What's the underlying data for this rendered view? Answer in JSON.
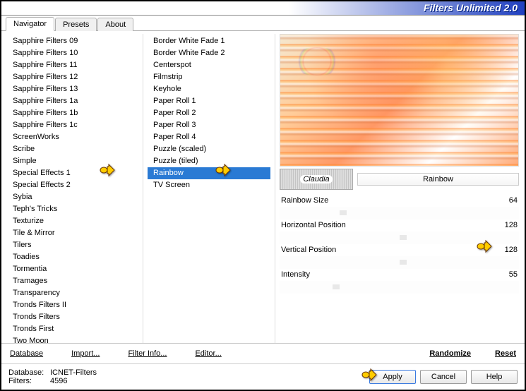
{
  "title": "Filters Unlimited 2.0",
  "tabs": [
    "Navigator",
    "Presets",
    "About"
  ],
  "activeTab": 0,
  "categories": [
    "Sapphire Filters 09",
    "Sapphire Filters 10",
    "Sapphire Filters 11",
    "Sapphire Filters 12",
    "Sapphire Filters 13",
    "Sapphire Filters 1a",
    "Sapphire Filters 1b",
    "Sapphire Filters 1c",
    "ScreenWorks",
    "Scribe",
    "Simple",
    "Special Effects 1",
    "Special Effects 2",
    "Sybia",
    "Teph's Tricks",
    "Texturize",
    "Tile & Mirror",
    "Tilers",
    "Toadies",
    "Tormentia",
    "Tramages",
    "Transparency",
    "Tronds Filters II",
    "Tronds Filters",
    "Tronds First",
    "Two Moon"
  ],
  "selectedCategoryIndex": 12,
  "filters": [
    "Border White Fade 1",
    "Border White Fade 2",
    "Centerspot",
    "Filmstrip",
    "Keyhole",
    "Paper Roll 1",
    "Paper Roll 2",
    "Paper Roll 3",
    "Paper Roll 4",
    "Puzzle (scaled)",
    "Puzzle (tiled)",
    "Rainbow",
    "TV Screen"
  ],
  "selectedFilterIndex": 11,
  "currentFilterName": "Rainbow",
  "logoText": "Claudia",
  "params": [
    {
      "label": "Rainbow Size",
      "value": "64",
      "pos": 25
    },
    {
      "label": "Horizontal Position",
      "value": "128",
      "pos": 50
    },
    {
      "label": "Vertical Position",
      "value": "128",
      "pos": 50
    },
    {
      "label": "Intensity",
      "value": "55",
      "pos": 22
    }
  ],
  "linkButtons": {
    "database": "Database",
    "import": "Import...",
    "filterInfo": "Filter Info...",
    "editor": "Editor...",
    "randomize": "Randomize",
    "reset": "Reset"
  },
  "buttons": {
    "apply": "Apply",
    "cancel": "Cancel",
    "help": "Help"
  },
  "status": {
    "dbLabel": "Database:",
    "dbValue": "ICNET-Filters",
    "filtersLabel": "Filters:",
    "filtersValue": "4596"
  }
}
